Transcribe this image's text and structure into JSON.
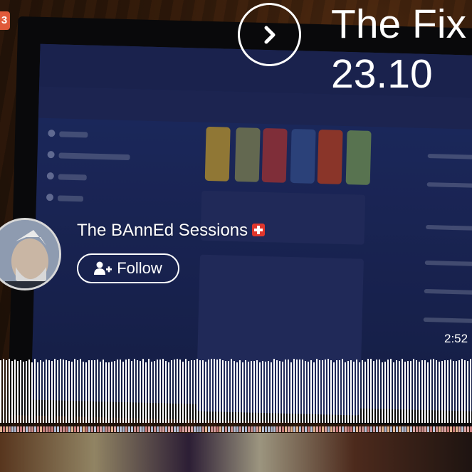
{
  "track": {
    "title_line1": "The Fix",
    "title_line2": "23.10",
    "duration": "2:52"
  },
  "uploader": {
    "name": "The BAnnEd Sessions"
  },
  "follow": {
    "label": "Follow"
  },
  "corner_badge": {
    "text": "3"
  },
  "icons": {
    "next": "chevron-right-icon",
    "follow": "add-user-icon",
    "pro": "pro-plus-badge-icon"
  },
  "colors": {
    "accent": "#e0362c",
    "text": "#ffffff",
    "waveform": "#ffffff"
  }
}
